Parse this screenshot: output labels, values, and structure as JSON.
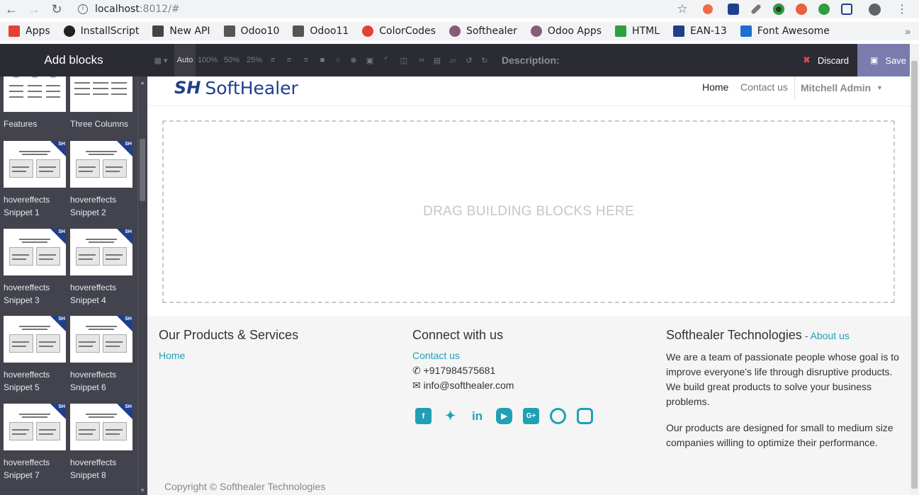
{
  "browser": {
    "url_host": "localhost",
    "url_path": ":8012/#",
    "bookmarks": [
      {
        "label": "Apps",
        "icon": "apps-grid-icon",
        "color": "#e34133"
      },
      {
        "label": "InstallScript",
        "icon": "github-icon",
        "color": "#222222"
      },
      {
        "label": "New API",
        "icon": "book-icon",
        "color": "#444444"
      },
      {
        "label": "Odoo10",
        "icon": "page-icon",
        "color": "#555555"
      },
      {
        "label": "Odoo11",
        "icon": "page-icon",
        "color": "#555555"
      },
      {
        "label": "ColorCodes",
        "icon": "color-wheel-icon",
        "color": "#e34133"
      },
      {
        "label": "Softhealer",
        "icon": "odoo-circle-icon",
        "color": "#875a7b"
      },
      {
        "label": "Odoo Apps",
        "icon": "odoo-circle-icon",
        "color": "#875a7b"
      },
      {
        "label": "HTML",
        "icon": "html-icon",
        "color": "#2e9e3e"
      },
      {
        "label": "EAN-13",
        "icon": "barcode-icon",
        "color": "#1f3f8c"
      },
      {
        "label": "Font Awesome",
        "icon": "flag-icon",
        "color": "#1c6ed1"
      }
    ]
  },
  "editor": {
    "add_blocks": "Add blocks",
    "tools": [
      "Auto",
      "100%",
      "50%",
      "25%"
    ],
    "description_label": "Description:",
    "discard_label": "Discard",
    "save_label": "Save"
  },
  "snippets": [
    {
      "label1": "Features",
      "label2": ""
    },
    {
      "label1": "Three Columns",
      "label2": ""
    },
    {
      "label1": "hovereffects",
      "label2": "Snippet 1"
    },
    {
      "label1": "hovereffects",
      "label2": "Snippet 2"
    },
    {
      "label1": "hovereffects",
      "label2": "Snippet 3"
    },
    {
      "label1": "hovereffects",
      "label2": "Snippet 4"
    },
    {
      "label1": "hovereffects",
      "label2": "Snippet 5"
    },
    {
      "label1": "hovereffects",
      "label2": "Snippet 6"
    },
    {
      "label1": "hovereffects",
      "label2": "Snippet 7"
    },
    {
      "label1": "hovereffects",
      "label2": "Snippet 8"
    }
  ],
  "site": {
    "logo_mark": "SH",
    "logo_word": "SoftHealer",
    "nav": {
      "home": "Home",
      "contact": "Contact us",
      "user": "Mitchell Admin"
    },
    "dropzone_text": "DRAG BUILDING BLOCKS HERE",
    "footer": {
      "col1_title": "Our Products & Services",
      "col1_link": "Home",
      "col2_title": "Connect with us",
      "col2_link": "Contact us",
      "phone": "+917984575681",
      "email": "info@softhealer.com",
      "col3_title": "Softhealer Technologies",
      "col3_dash": " - ",
      "col3_about": "About us",
      "para1": "We are a team of passionate people whose goal is to improve everyone's life through disruptive products. We build great products to solve your business problems.",
      "para2": "Our products are designed for small to medium size companies willing to optimize their performance.",
      "social": [
        "facebook-icon",
        "twitter-icon",
        "linkedin-icon",
        "youtube-icon",
        "google-plus-icon",
        "github-icon",
        "instagram-icon"
      ],
      "copyright": "Copyright © Softhealer Technologies"
    },
    "accent_color": "#21a0b5",
    "brand_color": "#1f3f8c"
  }
}
